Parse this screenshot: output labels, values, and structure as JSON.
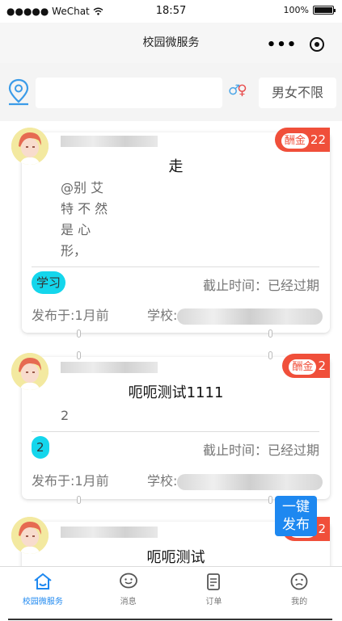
{
  "status_bar": {
    "carrier": "●●●●● WeChat",
    "time": "18:57",
    "battery": "100%"
  },
  "navbar": {
    "title": "校园微服务",
    "more": "•••"
  },
  "filter": {
    "search_value": "",
    "gender_symbol_male": "♂",
    "gender_symbol_female": "♀",
    "gender_option": "男女不限"
  },
  "posts": [
    {
      "reward_label": "酬金",
      "reward_amount": "22",
      "title": "走",
      "body": "@别 艾\n特 不 然\n是 心\n形，",
      "tag": "学习",
      "deadline": "截止时间：已经过期",
      "published": "发布于:1月前",
      "school_label": "学校:"
    },
    {
      "reward_label": "酬金",
      "reward_amount": "2",
      "title": "呃呃测试1111",
      "body": "2",
      "tag": "2",
      "deadline": "截止时间：已经过期",
      "published": "发布于:1月前",
      "school_label": "学校:"
    },
    {
      "reward_label": "酬金",
      "reward_amount": "2",
      "title": "呃呃测试"
    }
  ],
  "publish_button": {
    "line1": "一键",
    "line2": "发布"
  },
  "tabbar": [
    {
      "label": "校园微服务"
    },
    {
      "label": "消息"
    },
    {
      "label": "订单"
    },
    {
      "label": "我的"
    }
  ],
  "colors": {
    "accent": "#1e88f0",
    "reward": "#f04f3a",
    "tag": "#14d6ec"
  }
}
